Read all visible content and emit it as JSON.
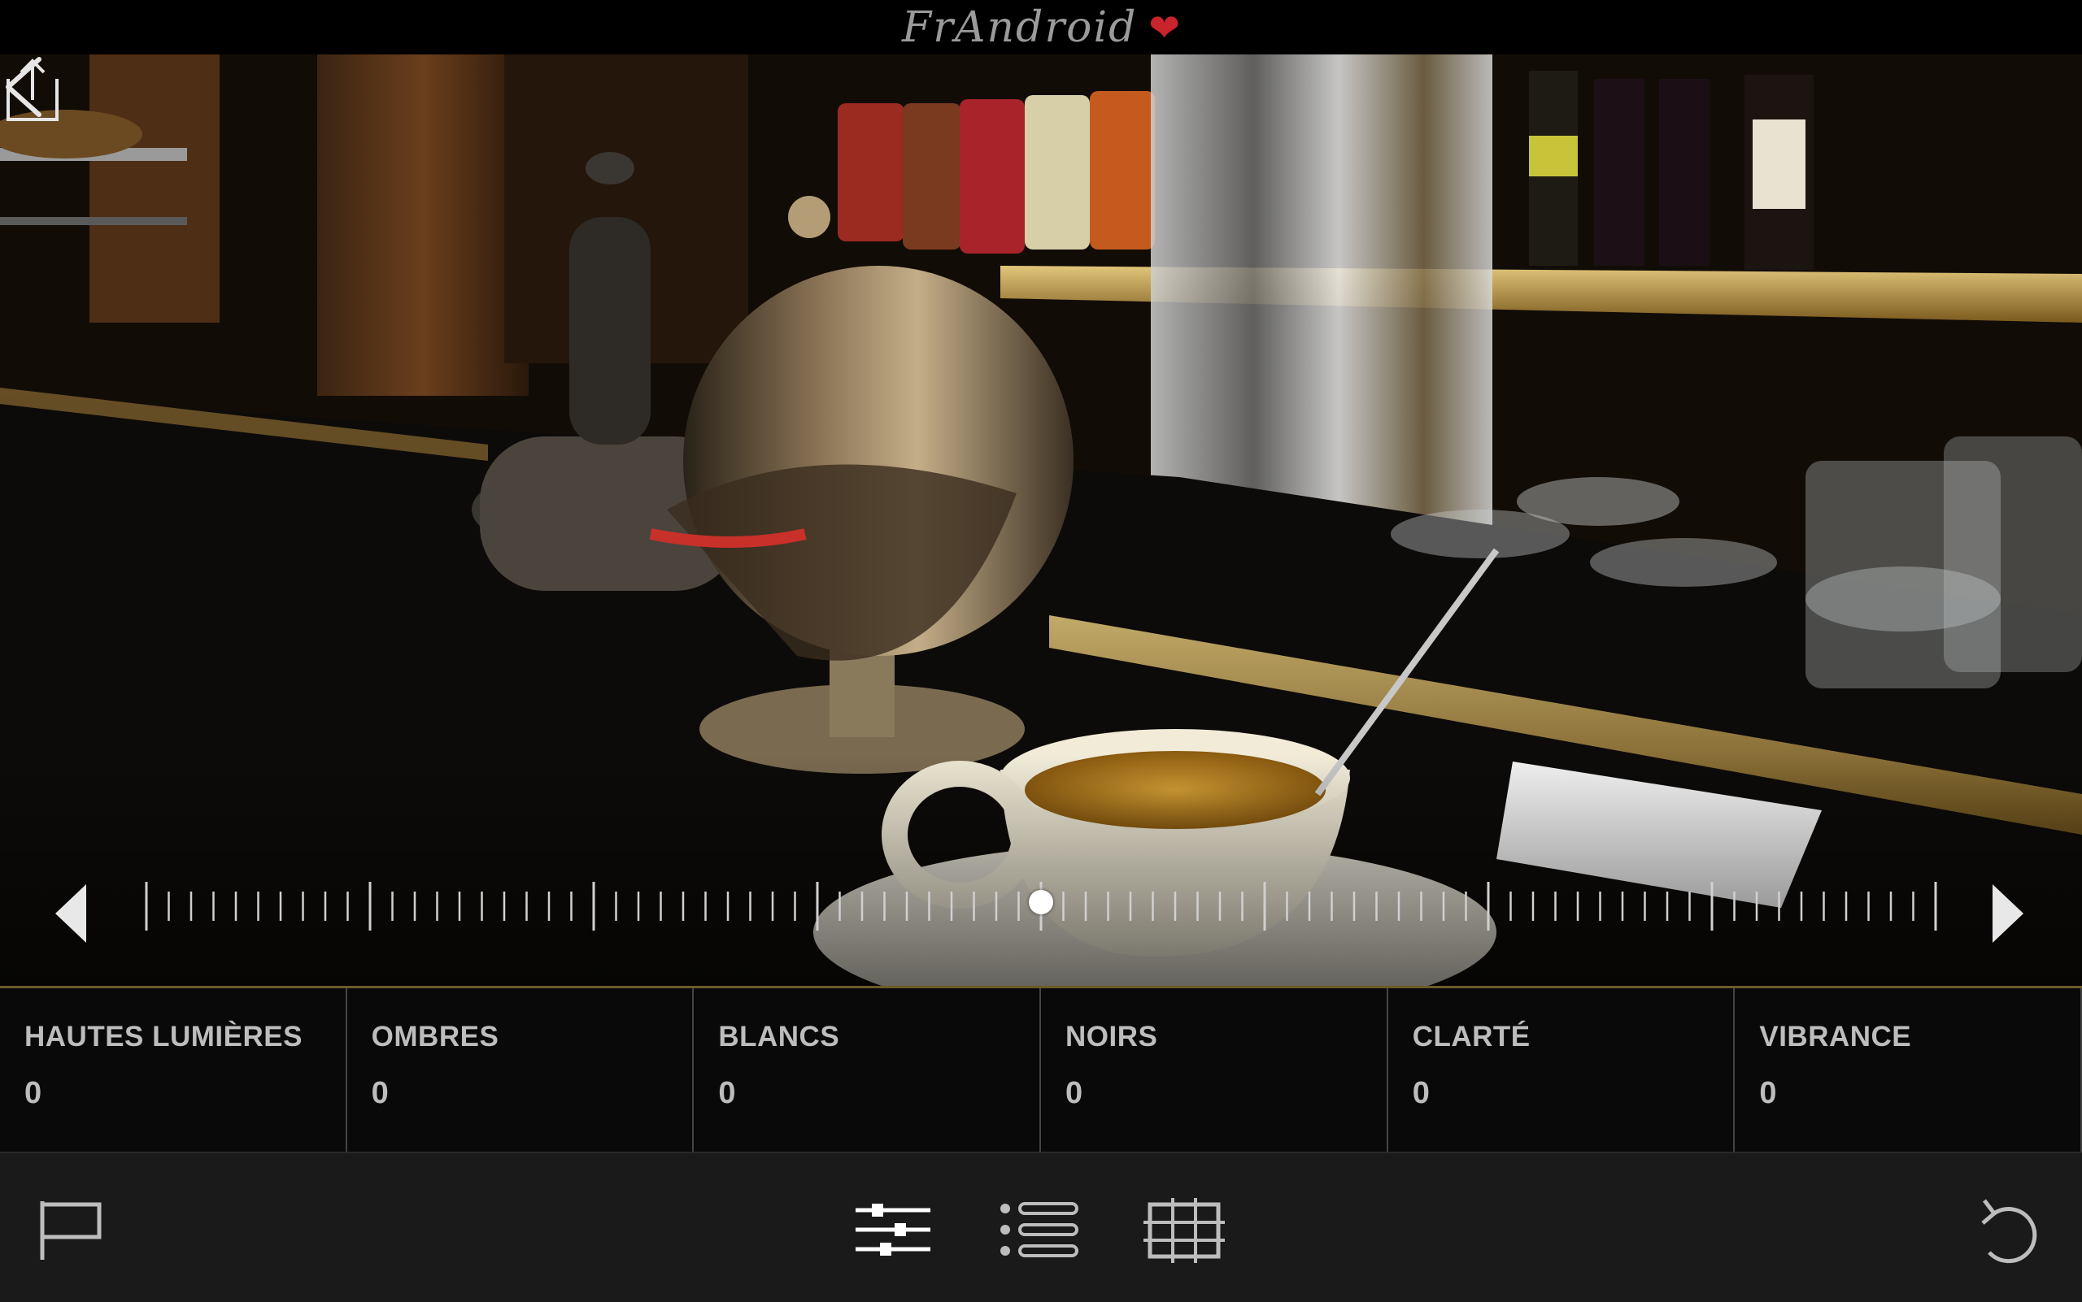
{
  "app": {
    "watermark": "FrAndroid",
    "heart_glyph": "❤"
  },
  "nav": {
    "back_icon": "chevron-left-icon",
    "share_icon": "share-icon"
  },
  "slider": {
    "value": 0,
    "min": -100,
    "max": 100,
    "thumb_color": "#ffffff"
  },
  "adjustments": [
    {
      "label": "HAUTES LUMIÈRES",
      "value": "0"
    },
    {
      "label": "OMBRES",
      "value": "0"
    },
    {
      "label": "BLANCS",
      "value": "0"
    },
    {
      "label": "NOIRS",
      "value": "0"
    },
    {
      "label": "CLARTÉ",
      "value": "0"
    },
    {
      "label": "VIBRANCE",
      "value": "0"
    }
  ],
  "toolbar": {
    "compare_icon": "flag-icon",
    "adjust_icon": "sliders-icon",
    "presets_icon": "list-icon",
    "crop_icon": "grid-icon",
    "undo_icon": "undo-icon"
  },
  "colors": {
    "accent": "#c9232b",
    "panel_border": "#6b5a2a",
    "toolbar_bg": "#1a1a1a",
    "icon": "#bdbdbd"
  }
}
